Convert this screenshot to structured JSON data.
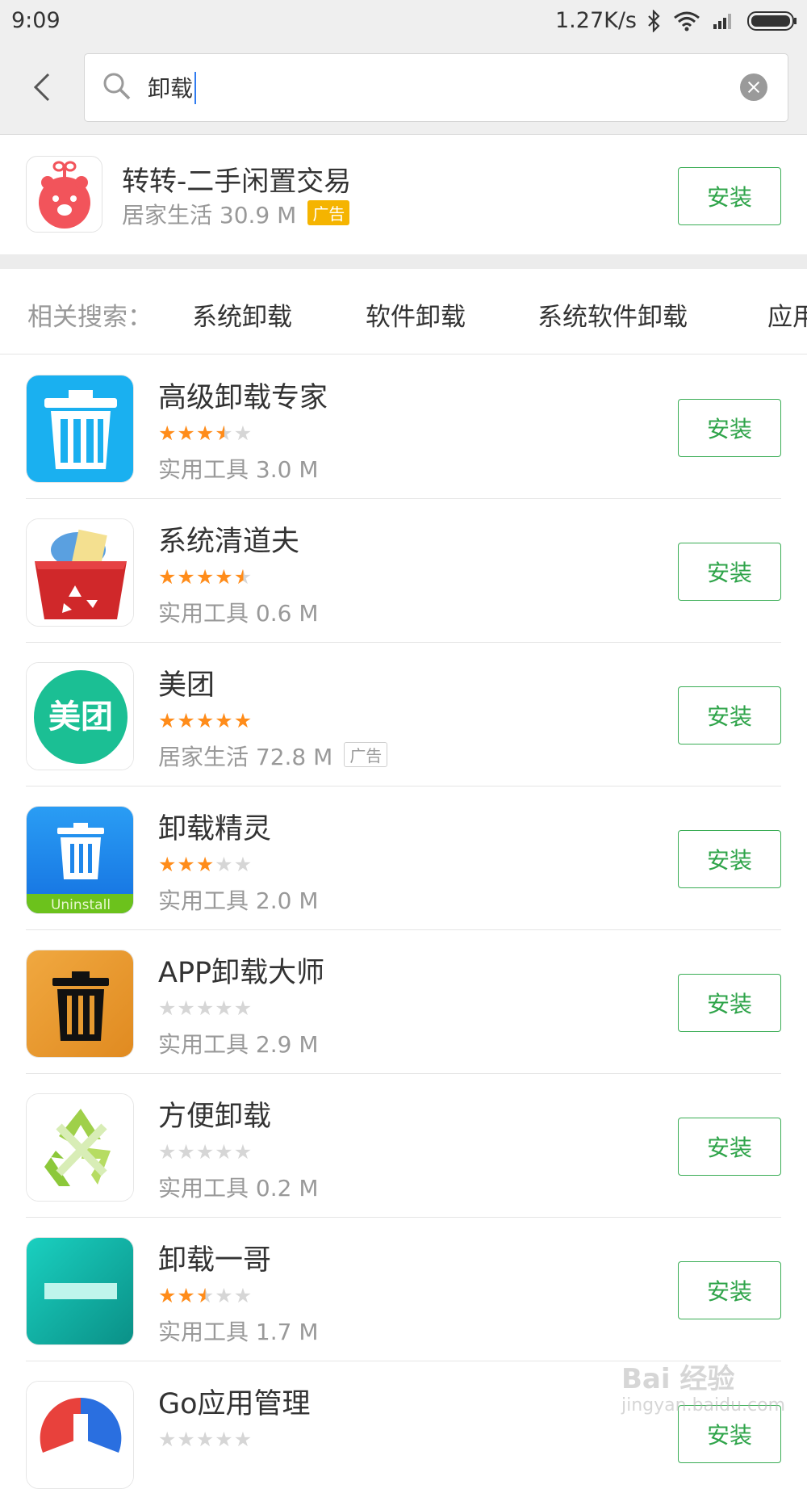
{
  "status_bar": {
    "time": "9:09",
    "speed": "1.27K/s"
  },
  "search": {
    "value": "卸载"
  },
  "ad_item": {
    "name": "转转-二手闲置交易",
    "meta": "居家生活 30.9 M",
    "badge": "广告",
    "install": "安装"
  },
  "related": {
    "label": "相关搜索：",
    "tags": [
      "系统卸载",
      "软件卸载",
      "系统软件卸载",
      "应用"
    ]
  },
  "apps": [
    {
      "name": "高级卸载专家",
      "rating": 3.5,
      "meta": "实用工具 3.0 M",
      "install": "安装"
    },
    {
      "name": "系统清道夫",
      "rating": 4.5,
      "meta": "实用工具 0.6 M",
      "install": "安装"
    },
    {
      "name": "美团",
      "rating": 5,
      "meta": "居家生活 72.8 M",
      "badge": "广告",
      "icon_text": "美团",
      "install": "安装"
    },
    {
      "name": "卸载精灵",
      "rating": 3,
      "meta": "实用工具 2.0 M",
      "icon_text": "Uninstall",
      "install": "安装"
    },
    {
      "name": "APP卸载大师",
      "rating": 0,
      "meta": "实用工具 2.9 M",
      "install": "安装"
    },
    {
      "name": "方便卸载",
      "rating": 0,
      "meta": "实用工具 0.2 M",
      "install": "安装"
    },
    {
      "name": "卸载一哥",
      "rating": 2.5,
      "meta": "实用工具 1.7 M",
      "install": "安装"
    },
    {
      "name": "Go应用管理",
      "rating": 0,
      "meta": "",
      "install": "安装"
    }
  ],
  "watermark": {
    "line1": "Bai 经验",
    "line2": "jingyan.baidu.com"
  },
  "colors": {
    "accent": "#3aad55",
    "star": "#ff8c1a",
    "ad_badge": "#f5b400"
  }
}
